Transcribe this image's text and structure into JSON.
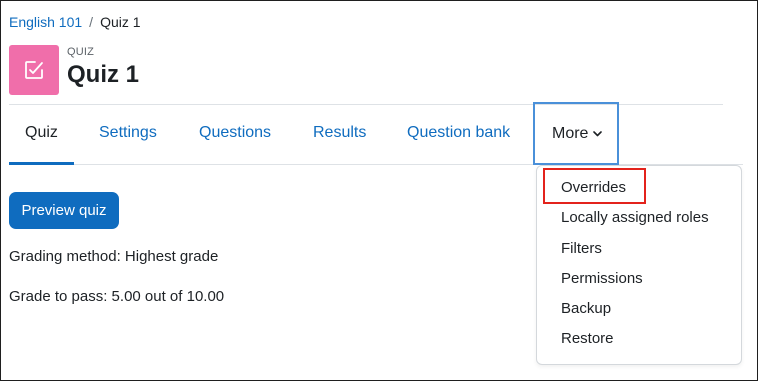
{
  "breadcrumb": {
    "course": "English 101",
    "separator": "/",
    "current": "Quiz 1"
  },
  "header": {
    "label": "QUIZ",
    "title": "Quiz 1",
    "icon": "quiz-checkbox-icon",
    "icon_color": "#f06eaa"
  },
  "tabs": [
    {
      "label": "Quiz",
      "active": true
    },
    {
      "label": "Settings"
    },
    {
      "label": "Questions"
    },
    {
      "label": "Results"
    },
    {
      "label": "Question bank"
    }
  ],
  "more_tab": {
    "label": "More",
    "icon": "chevron-down-icon",
    "expanded": true
  },
  "more_menu": {
    "items": [
      "Overrides",
      "Locally assigned roles",
      "Filters",
      "Permissions",
      "Backup",
      "Restore"
    ],
    "highlighted": "Overrides"
  },
  "main": {
    "preview_button": "Preview quiz",
    "grading_method": "Grading method: Highest grade",
    "grade_to_pass": "Grade to pass: 5.00 out of 10.00"
  },
  "colors": {
    "link": "#0f6cbf",
    "primary_button": "#0f6cbf",
    "highlight_box": "#e3231c",
    "more_tab_border": "#4a90d9"
  }
}
